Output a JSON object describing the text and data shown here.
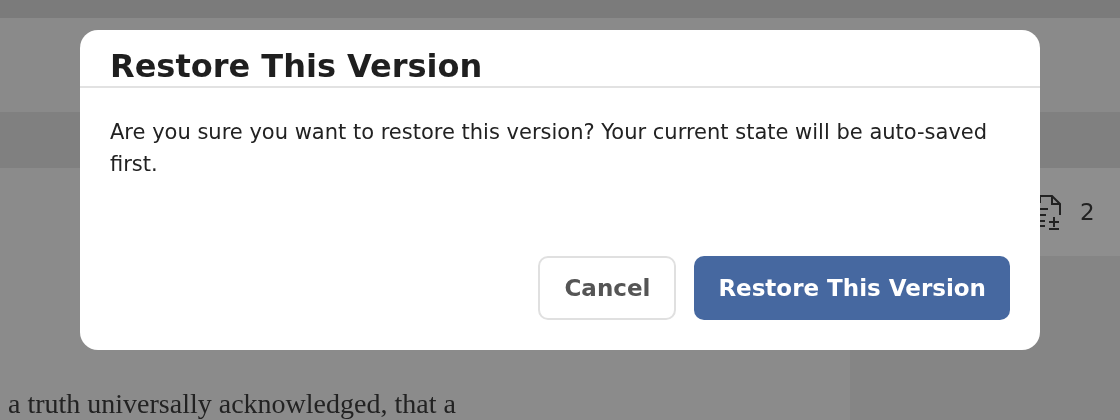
{
  "background": {
    "document_text": "a truth universally acknowledged, that a",
    "stats_count": "2"
  },
  "dialog": {
    "title": "Restore This Version",
    "message": "Are you sure you want to restore this version? Your current state will be auto-saved first.",
    "buttons": [
      {
        "label": "Cancel",
        "kind": "secondary"
      },
      {
        "label": "Restore This Version",
        "kind": "primary"
      }
    ]
  }
}
